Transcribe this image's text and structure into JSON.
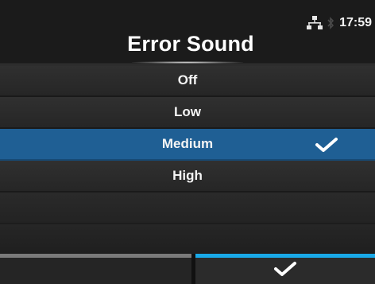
{
  "header": {
    "title": "Error Sound",
    "time": "17:59",
    "network_icon": "network-icon",
    "bluetooth_icon": "bluetooth-icon"
  },
  "options": [
    {
      "label": "Off",
      "selected": false
    },
    {
      "label": "Low",
      "selected": false
    },
    {
      "label": "Medium",
      "selected": true
    },
    {
      "label": "High",
      "selected": false
    }
  ],
  "footer": {
    "left_button": "",
    "confirm_icon": "checkmark-icon"
  },
  "colors": {
    "selected_row": "#1f5f94",
    "confirm_accent": "#19a9e8",
    "left_accent": "#7a7a7a"
  }
}
